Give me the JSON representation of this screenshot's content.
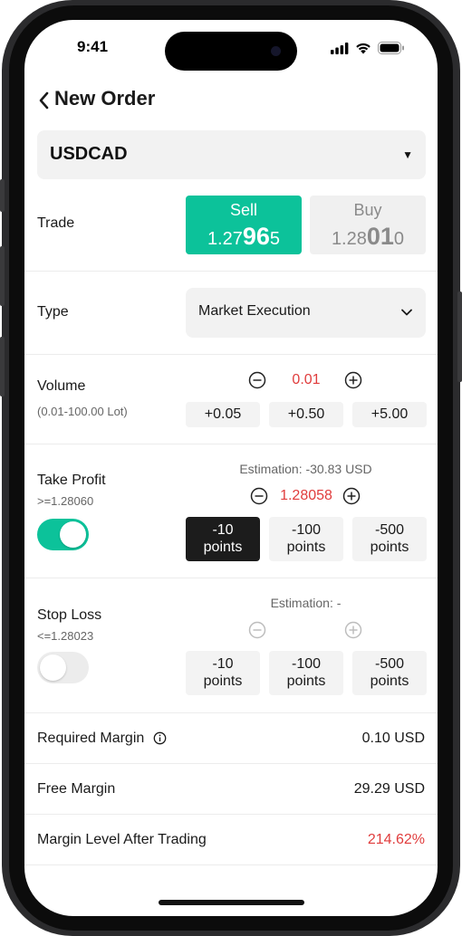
{
  "status_bar": {
    "time": "9:41"
  },
  "header": {
    "title": "New Order"
  },
  "symbol": {
    "value": "USDCAD"
  },
  "trade": {
    "label": "Trade",
    "sell": {
      "label": "Sell",
      "price_prefix": "1.27",
      "price_big": "96",
      "price_suffix": "5"
    },
    "buy": {
      "label": "Buy",
      "price_prefix": "1.28",
      "price_big": "01",
      "price_suffix": "0"
    }
  },
  "type": {
    "label": "Type",
    "value": "Market Execution"
  },
  "volume": {
    "label": "Volume",
    "range": "(0.01-100.00 Lot)",
    "value": "0.01",
    "quick_adds": [
      "+0.05",
      "+0.50",
      "+5.00"
    ]
  },
  "take_profit": {
    "label": "Take Profit",
    "condition": ">=1.28060",
    "estimation": "Estimation: -30.83 USD",
    "value": "1.28058",
    "enabled": true,
    "points": [
      {
        "line1": "-10",
        "line2": "points"
      },
      {
        "line1": "-100",
        "line2": "points"
      },
      {
        "line1": "-500",
        "line2": "points"
      }
    ]
  },
  "stop_loss": {
    "label": "Stop Loss",
    "condition": "<=1.28023",
    "estimation": "Estimation: -",
    "enabled": false,
    "points": [
      {
        "line1": "-10",
        "line2": "points"
      },
      {
        "line1": "-100",
        "line2": "points"
      },
      {
        "line1": "-500",
        "line2": "points"
      }
    ]
  },
  "summary": {
    "required_margin": {
      "label": "Required Margin",
      "value": "0.10 USD"
    },
    "free_margin": {
      "label": "Free Margin",
      "value": "29.29 USD"
    },
    "margin_level": {
      "label": "Margin Level After Trading",
      "value": "214.62%"
    }
  },
  "colors": {
    "accent": "#0cc29a",
    "negative": "#e03c3c",
    "dark_chip": "#1c1c1c"
  }
}
